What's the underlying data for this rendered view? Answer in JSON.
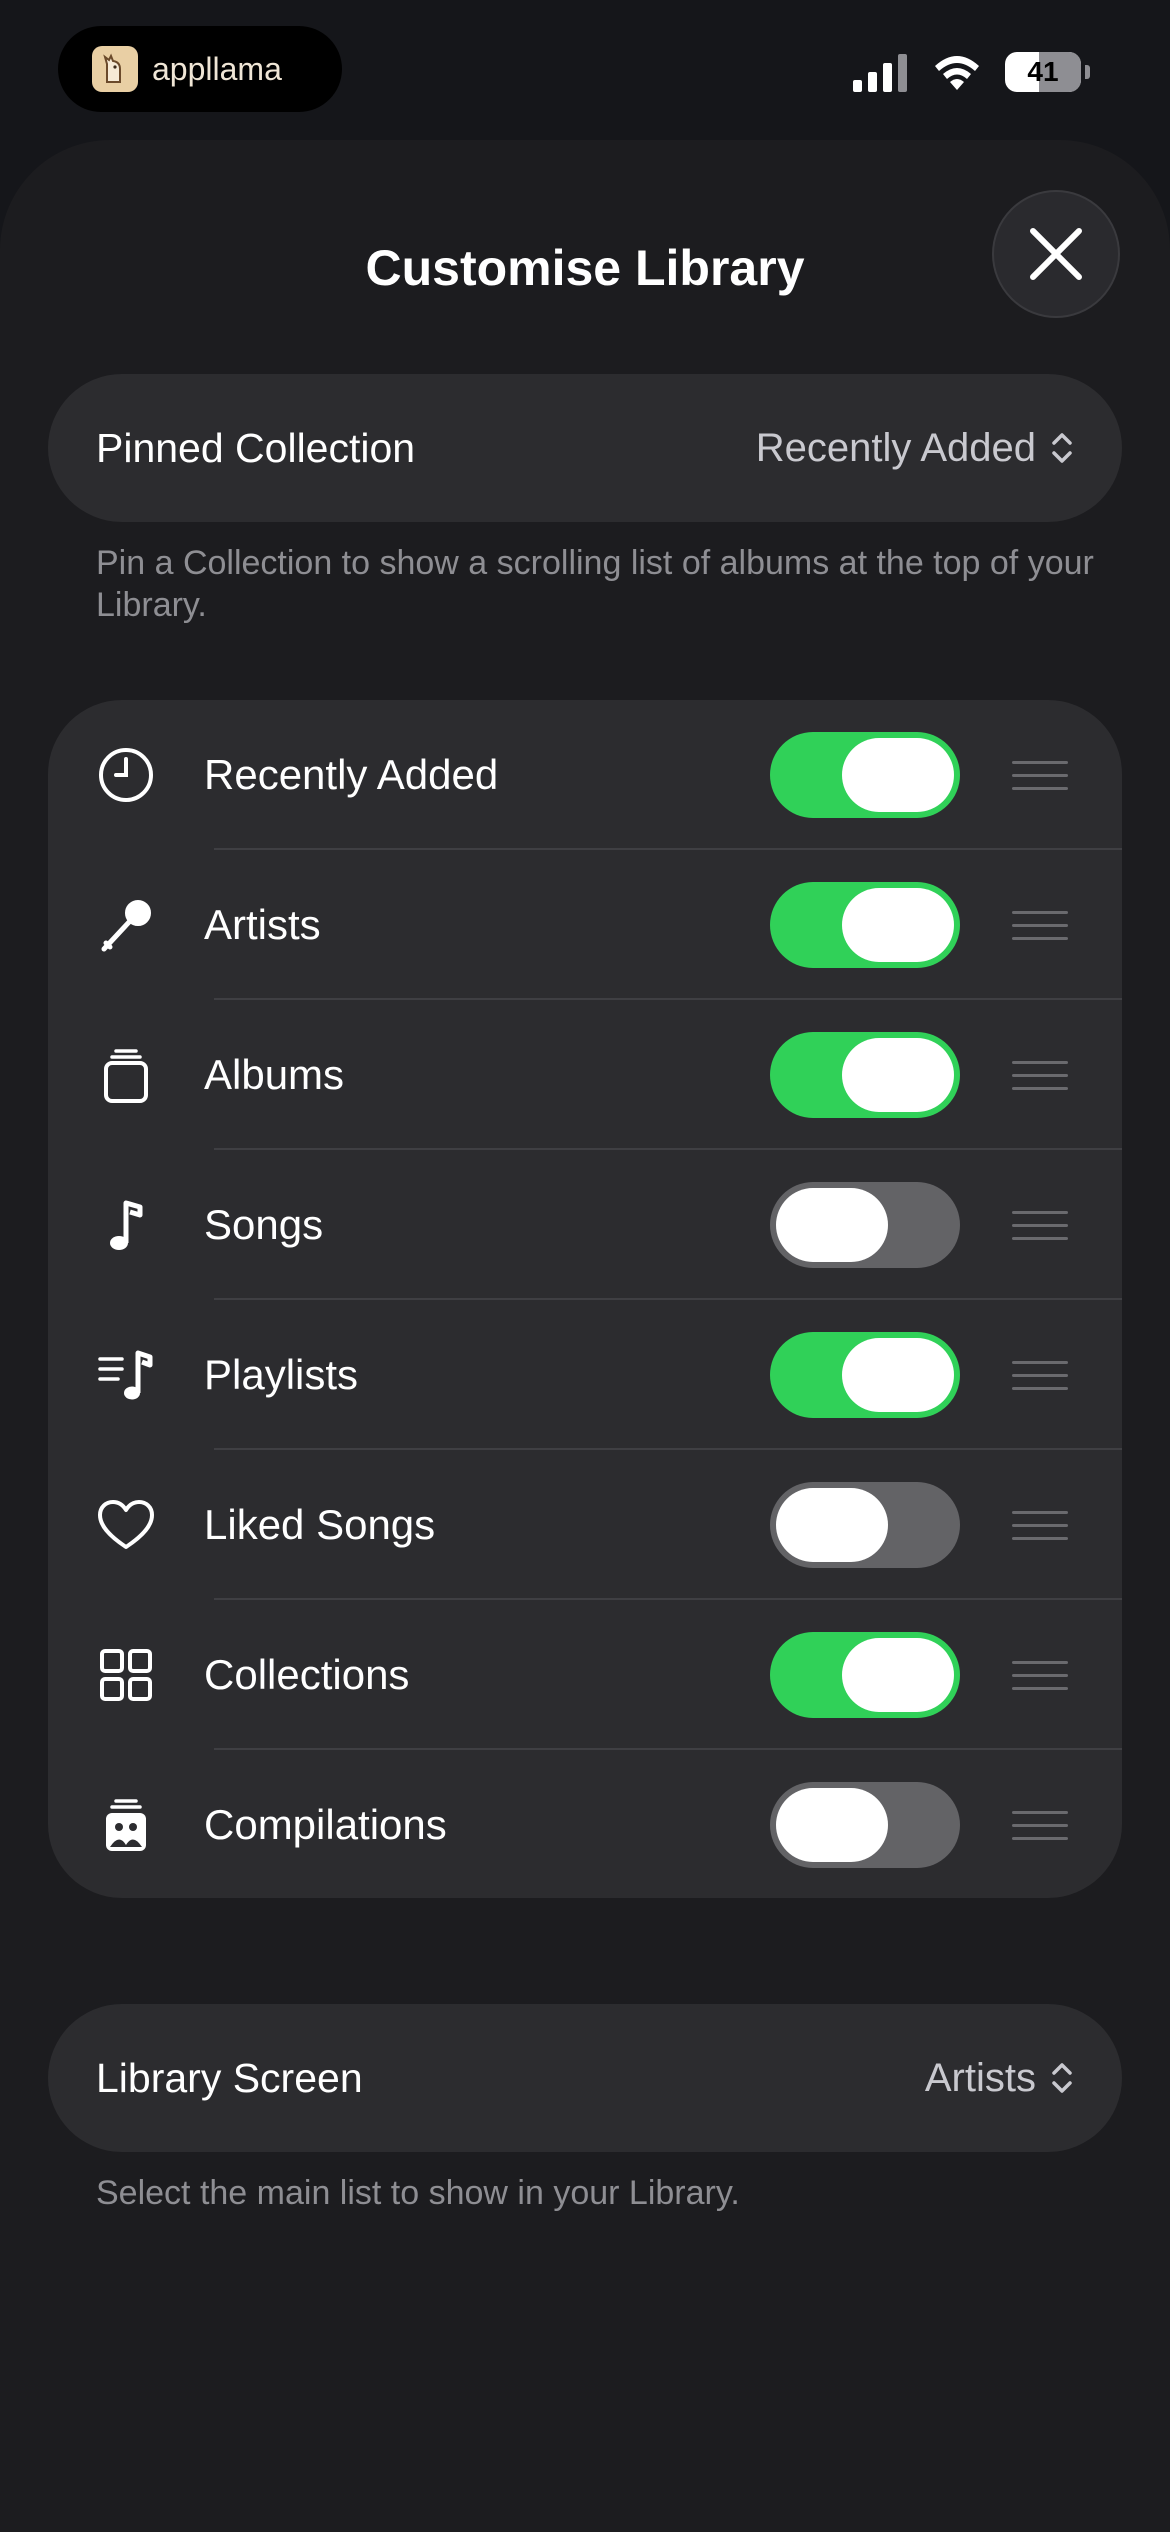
{
  "status": {
    "brand": "appllama",
    "battery": "41",
    "battery_level": 0.41
  },
  "sheet": {
    "title": "Customise Library",
    "close_icon": "close-icon"
  },
  "pinned": {
    "label": "Pinned Collection",
    "value": "Recently Added",
    "note": "Pin a Collection to show a scrolling list of albums at the top of your Library."
  },
  "items": [
    {
      "label": "Recently Added",
      "icon": "clock-icon",
      "enabled": true
    },
    {
      "label": "Artists",
      "icon": "microphone-icon",
      "enabled": true
    },
    {
      "label": "Albums",
      "icon": "album-stack-icon",
      "enabled": true
    },
    {
      "label": "Songs",
      "icon": "music-note-icon",
      "enabled": false
    },
    {
      "label": "Playlists",
      "icon": "playlist-icon",
      "enabled": true
    },
    {
      "label": "Liked Songs",
      "icon": "heart-icon",
      "enabled": false
    },
    {
      "label": "Collections",
      "icon": "grid-icon",
      "enabled": true
    },
    {
      "label": "Compilations",
      "icon": "compilation-icon",
      "enabled": false
    }
  ],
  "library_screen": {
    "label": "Library Screen",
    "value": "Artists",
    "note": "Select the main list to show in your Library."
  },
  "colors": {
    "accent_on": "#30d158",
    "toggle_off": "#636366",
    "background": "#15161a",
    "card": "#2c2c2f"
  }
}
